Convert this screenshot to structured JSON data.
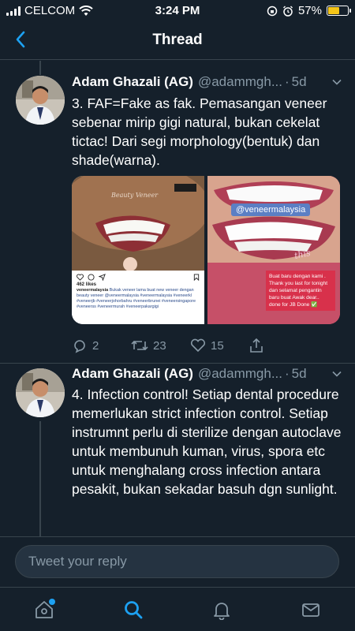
{
  "status_bar": {
    "carrier": "CELCOM",
    "time": "3:24 PM",
    "battery": "57%",
    "battery_level": 0.57,
    "battery_color": "#f5c518"
  },
  "header": {
    "title": "Thread"
  },
  "tweets": [
    {
      "name": "Adam Ghazali (AG)",
      "handle": "@adammgh...",
      "time": "5d",
      "text": "3. FAF=Fake as fak. Pemasangan veneer sebenar mirip gigi natural, bukan cekelat tictac! Dari segi morphology(bentuk) dan shade(warna).",
      "media": {
        "left": {
          "watermark": "Beauty Veneer",
          "likes": "462 likes",
          "caption_user": "veneermalaysia",
          "caption": "Bukak veneer lama buat new veneer dengan beauty veneer @veneermalaysia #veneermalaysia #veneerkl #veneerjb #veneerjohorbahru #veneerbrunei #veneersingapore #veneerss #veneermurah #veneerpakargigi"
        },
        "right": {
          "tag": "@veneermalaysia",
          "sticker": "this",
          "message": "Buat baru dengan kami . Thank you last for tonight dan selamat pengantin baru buat Awak dear.. done for JB Done ✅"
        }
      },
      "actions": {
        "replies": "2",
        "retweets": "23",
        "likes": "15"
      }
    },
    {
      "name": "Adam Ghazali (AG)",
      "handle": "@adammgh...",
      "time": "5d",
      "text": "4. Infection control! Setiap dental procedure memerlukan strict infection control. Setiap instrumnt perlu di sterilize dengan autoclave untuk membunuh kuman, virus, spora etc untuk menghalang cross infection antara pesakit, bukan sekadar basuh dgn sunlight."
    }
  ],
  "reply": {
    "placeholder": "Tweet your reply"
  },
  "tabbar": {
    "items": [
      "home-icon",
      "search-icon",
      "notifications-icon",
      "messages-icon"
    ],
    "active": "search-icon",
    "accent": "#1da1f2"
  }
}
